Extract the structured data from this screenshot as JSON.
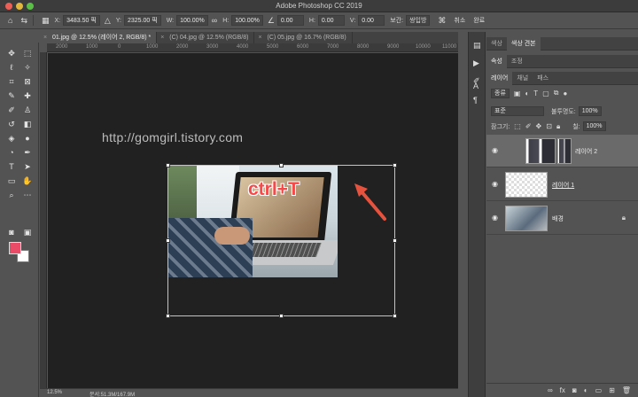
{
  "window": {
    "title": "Adobe Photoshop CC 2019"
  },
  "options_bar": {
    "x_label": "X:",
    "x_value": "3483.50 픽",
    "y_label": "Y:",
    "y_value": "2325.00 픽",
    "w_label": "W:",
    "w_value": "100.00%",
    "h_label": "H:",
    "h_value": "100.00%",
    "angle_value": "0.00",
    "hskew_label": "H:",
    "hskew_value": "0.00",
    "vskew_label": "V:",
    "vskew_value": "0.00",
    "interp_label": "보간:",
    "interp_value": "쌍입방",
    "cancel_label": "취소",
    "commit_label": "완료"
  },
  "tabs": [
    {
      "label": "01.jpg @ 12.5% (레이어 2, RGB/8) *",
      "active": true
    },
    {
      "label": "(C) 04.jpg @ 12.5% (RGB/8)",
      "active": false
    },
    {
      "label": "(C) 05.jpg @ 16.7% (RGB/8)",
      "active": false
    }
  ],
  "ruler": {
    "h_ticks": [
      "2000",
      "1000",
      "0",
      "1000",
      "2000",
      "3000",
      "4000",
      "5000",
      "6000",
      "7000",
      "8000",
      "9000",
      "10000",
      "11000"
    ]
  },
  "canvas": {
    "watermark": "http://gomgirl.tistory.com",
    "overlay_text": "ctrl+T"
  },
  "status": {
    "zoom": "12.5%",
    "doc": "문서:51.3M/167.9M"
  },
  "panel": {
    "top_tabs": [
      "색상",
      "색상 견본"
    ],
    "mid_tabs": [
      "속성",
      "조정"
    ],
    "layer_tabs": [
      "레이어",
      "채널",
      "패스"
    ],
    "kind_filter": "종류",
    "blend_mode": "표준",
    "opacity_label": "불투명도:",
    "opacity_value": "100%",
    "lock_label": "잠그기:",
    "fill_label": "칠:",
    "fill_value": "100%",
    "layers": [
      {
        "name": "레이어 2",
        "selected": true
      },
      {
        "name": "레이어 1",
        "selected": false
      },
      {
        "name": "배경",
        "selected": false
      }
    ]
  },
  "colors": {
    "foreground": "#ea4b67",
    "background": "#ffffff",
    "accent_arrow": "#e5533f"
  }
}
